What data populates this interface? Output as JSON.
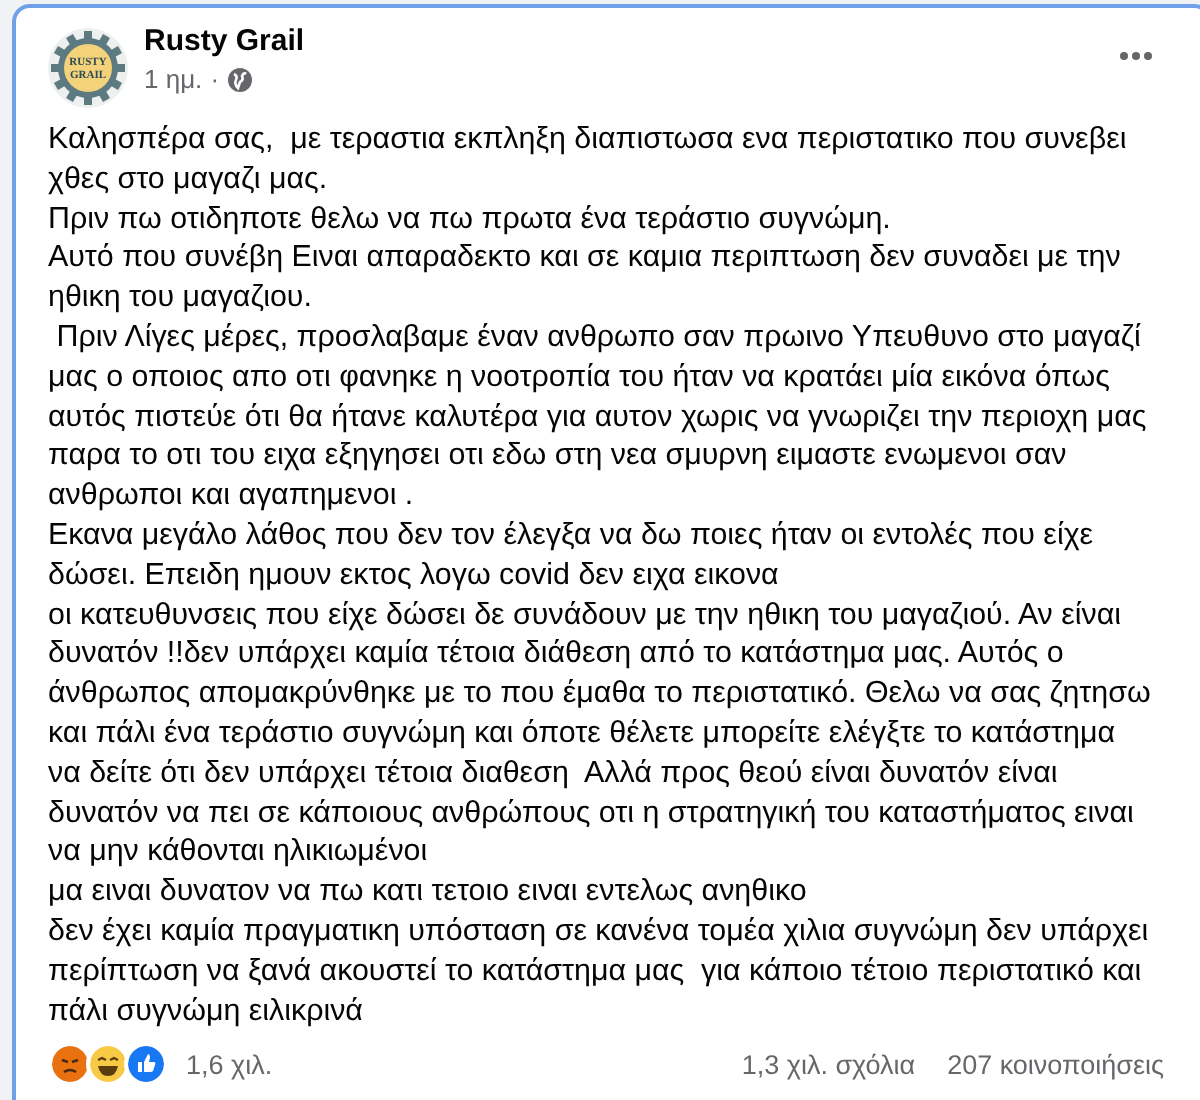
{
  "post": {
    "author": "Rusty Grail",
    "avatar_text": [
      "RUSTY",
      "GRAIL"
    ],
    "time": "1 ημ.",
    "separator": "·",
    "paragraphs": [
      "Καλησπέρα σας,  με τεραστια εκπληξη διαπιστωσα ενα περιστατικο που συνεβει χθες στο μαγαζι μας.",
      "Πριν πω οτιδηποτε θελω να πω πρωτα ένα τεράστιο συγνώμη.",
      "Αυτό που συνέβη Ειναι απαραδεκτο και σε καμια περιπτωση δεν συναδει με την ηθικη του μαγαζιου.",
      " Πριν Λίγες μέρες, προσλαβαμε έναν ανθρωπο σαν πρωινο Υπευθυνο στο μαγαζί μας ο οποιος απο οτι φανηκε η νοοτροπία του ήταν να κρατάει μία εικόνα όπως αυτός πιστεύε ότι θα ήτανε καλυτέρα για αυτον χωρις να γνωριζει την περιοχη μας παρα το οτι του ειχα εξηγησει οτι εδω στη νεα σμυρνη ειμαστε ενωμενοι σαν ανθρωποι και αγαπημενοι .",
      "Εκανα μεγάλο λάθος που δεν τον έλεγξα να δω ποιες ήταν οι εντολές που είχε δώσει. Επειδη ημουν εκτος λογω covid δεν ειχα εικονα",
      "οι κατευθυνσεις που είχε δώσει δε συνάδουν με την ηθικη του μαγαζιού. Αν είναι δυνατόν !!δεν υπάρχει καμία τέτοια διάθεση από το κατάστημα μας. Αυτός ο άνθρωπος απομακρύνθηκε με το που έμαθα το περιστατικό. Θελω να σας ζητησω και πάλι ένα τεράστιο συγνώμη και όποτε θέλετε μπορείτε ελέγξτε το κατάστημα να δείτε ότι δεν υπάρχει τέτοια διαθεση  Αλλά προς θεού είναι δυνατόν είναι δυνατόν να πει σε κάποιους ανθρώπους οτι η στρατηγική του καταστήματος ειναι να μην κάθονται ηλικιωμένοι",
      "μα ειναι δυνατον να πω κατι τετοιο ειναι εντελως ανηθικο",
      "δεν έχει καμία πραγματικη υπόσταση σε κανένα τομέα χιλια συγνώμη δεν υπάρχει περίπτωση να ξανά ακουστεί το κατάστημα μας  για κάποιο τέτοιο περιστατικό και πάλι συγνώμη ειλικρινά"
    ],
    "reactions": [
      {
        "kind": "angry"
      },
      {
        "kind": "haha"
      },
      {
        "kind": "like"
      }
    ],
    "reaction_count": "1,6 χιλ.",
    "comments": "1,3 χιλ. σχόλια",
    "shares": "207 κοινοποιήσεις"
  }
}
